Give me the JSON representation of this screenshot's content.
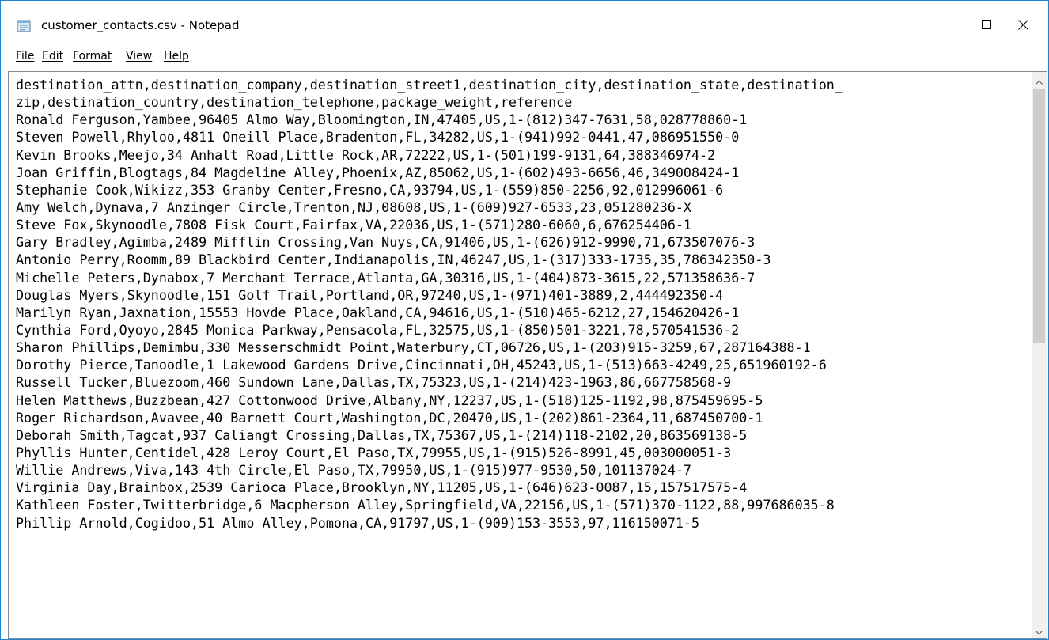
{
  "window": {
    "title": "customer_contacts.csv - Notepad",
    "icons": {
      "app": "notepad-icon",
      "minimize": "minimize-icon",
      "maximize": "maximize-icon",
      "close": "close-icon"
    }
  },
  "menu": {
    "items": [
      {
        "label": "File"
      },
      {
        "label": "Edit"
      },
      {
        "label": "Format"
      },
      {
        "label": "View"
      },
      {
        "label": "Help"
      }
    ]
  },
  "document": {
    "lines": [
      "destination_attn,destination_company,destination_street1,destination_city,destination_state,destination_",
      "zip,destination_country,destination_telephone,package_weight,reference",
      "Ronald Ferguson,Yambee,96405 Almo Way,Bloomington,IN,47405,US,1-(812)347-7631,58,028778860-1",
      "Steven Powell,Rhyloo,4811 Oneill Place,Bradenton,FL,34282,US,1-(941)992-0441,47,086951550-0",
      "Kevin Brooks,Meejo,34 Anhalt Road,Little Rock,AR,72222,US,1-(501)199-9131,64,388346974-2",
      "Joan Griffin,Blogtags,84 Magdeline Alley,Phoenix,AZ,85062,US,1-(602)493-6656,46,349008424-1",
      "Stephanie Cook,Wikizz,353 Granby Center,Fresno,CA,93794,US,1-(559)850-2256,92,012996061-6",
      "Amy Welch,Dynava,7 Anzinger Circle,Trenton,NJ,08608,US,1-(609)927-6533,23,051280236-X",
      "Steve Fox,Skynoodle,7808 Fisk Court,Fairfax,VA,22036,US,1-(571)280-6060,6,676254406-1",
      "Gary Bradley,Agimba,2489 Mifflin Crossing,Van Nuys,CA,91406,US,1-(626)912-9990,71,673507076-3",
      "Antonio Perry,Roomm,89 Blackbird Center,Indianapolis,IN,46247,US,1-(317)333-1735,35,786342350-3",
      "Michelle Peters,Dynabox,7 Merchant Terrace,Atlanta,GA,30316,US,1-(404)873-3615,22,571358636-7",
      "Douglas Myers,Skynoodle,151 Golf Trail,Portland,OR,97240,US,1-(971)401-3889,2,444492350-4",
      "Marilyn Ryan,Jaxnation,15553 Hovde Place,Oakland,CA,94616,US,1-(510)465-6212,27,154620426-1",
      "Cynthia Ford,Oyoyo,2845 Monica Parkway,Pensacola,FL,32575,US,1-(850)501-3221,78,570541536-2",
      "Sharon Phillips,Demimbu,330 Messerschmidt Point,Waterbury,CT,06726,US,1-(203)915-3259,67,287164388-1",
      "Dorothy Pierce,Tanoodle,1 Lakewood Gardens Drive,Cincinnati,OH,45243,US,1-(513)663-4249,25,651960192-6",
      "Russell Tucker,Bluezoom,460 Sundown Lane,Dallas,TX,75323,US,1-(214)423-1963,86,667758568-9",
      "Helen Matthews,Buzzbean,427 Cottonwood Drive,Albany,NY,12237,US,1-(518)125-1192,98,875459695-5",
      "Roger Richardson,Avavee,40 Barnett Court,Washington,DC,20470,US,1-(202)861-2364,11,687450700-1",
      "Deborah Smith,Tagcat,937 Caliangt Crossing,Dallas,TX,75367,US,1-(214)118-2102,20,863569138-5",
      "Phyllis Hunter,Centidel,428 Leroy Court,El Paso,TX,79955,US,1-(915)526-8991,45,003000051-3",
      "Willie Andrews,Viva,143 4th Circle,El Paso,TX,79950,US,1-(915)977-9530,50,101137024-7",
      "Virginia Day,Brainbox,2539 Carioca Place,Brooklyn,NY,11205,US,1-(646)623-0087,15,157517575-4",
      "Kathleen Foster,Twitterbridge,6 Macpherson Alley,Springfield,VA,22156,US,1-(571)370-1122,88,997686035-8",
      "Phillip Arnold,Cogidoo,51 Almo Alley,Pomona,CA,91797,US,1-(909)153-3553,97,116150071-5"
    ]
  },
  "scrollbar": {
    "up_icon": "chevron-up-icon",
    "down_icon": "chevron-down-icon"
  },
  "colors": {
    "window_border": "#1883d7",
    "scroll_track": "#f0f0f0",
    "scroll_thumb": "#cdcdcd",
    "text": "#000000"
  }
}
